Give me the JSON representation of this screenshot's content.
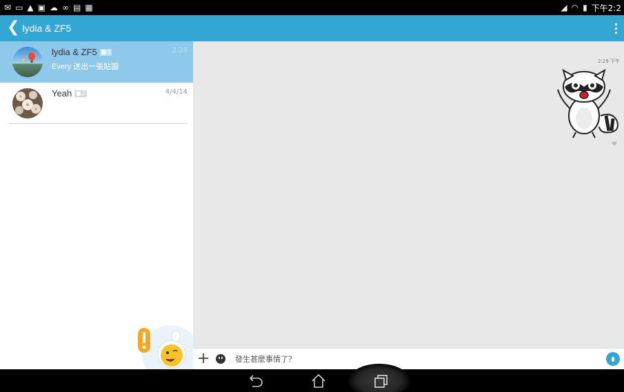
{
  "status_bar": {
    "left_icons": [
      "mail-icon",
      "message-icon",
      "warning-icon",
      "store-icon",
      "cloud-icon",
      "voicemail-icon",
      "sim-icon",
      "clipboard-icon"
    ],
    "right_icons": [
      "no-signal-icon",
      "wifi-icon",
      "battery-icon"
    ],
    "time": "下午2:2"
  },
  "action_bar": {
    "title": "lydia & ZF5",
    "color": "#33a7d3"
  },
  "conversations": [
    {
      "name": "lydia & ZF5",
      "member_count": "3",
      "preview": "Every 送出一張貼圖",
      "time": "2:29",
      "selected": true
    },
    {
      "name": "Yeah",
      "member_count": "2",
      "preview": "",
      "time": "4/4/14",
      "selected": false
    }
  ],
  "messages": [
    {
      "time": "2:29 下午",
      "type": "sticker",
      "sticker": "raccoon-sticker"
    }
  ],
  "input": {
    "placeholder": "發生甚麼事情了？"
  },
  "colors": {
    "accent": "#33a7d3",
    "selected_row": "#8ec8ea",
    "conversation_bg": "#e8e8e8"
  }
}
